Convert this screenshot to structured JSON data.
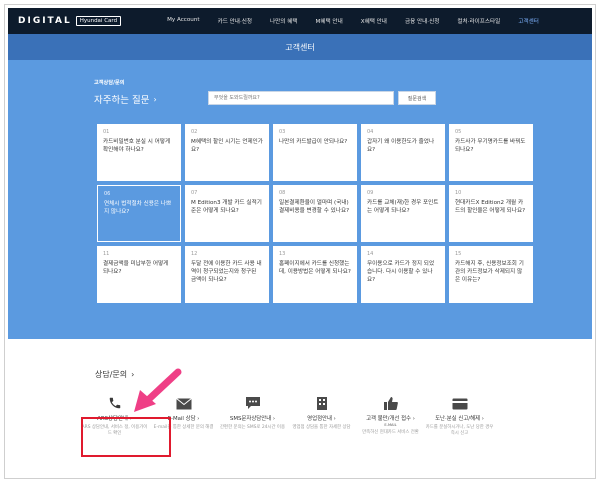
{
  "nav": {
    "logo_text": "DIGITAL",
    "logo_badge": "Hyundai Card",
    "items": [
      "My Account",
      "카드 안내·신청",
      "나만의 혜택",
      "M혜택 안내",
      "X혜택 안내",
      "금융 안내·신청",
      "컬처·라이프스타일",
      "고객센터"
    ]
  },
  "header": {
    "title": "고객센터"
  },
  "faq": {
    "breadcrumb": "고객상담/문의",
    "heading": "자주하는 질문",
    "search_placeholder": "무엇을 도와드릴까요?",
    "search_button": "질문검색",
    "cards": [
      {
        "num": "01",
        "text": "카드비밀번호 분실 시 어떻게 확인해야 하나요?"
      },
      {
        "num": "02",
        "text": "M혜택의 할인 시기는 언제인가요?"
      },
      {
        "num": "03",
        "text": "나만의 카드발급이 안되나요?"
      },
      {
        "num": "04",
        "text": "갑자기 왜 이용한도가 줄었나요?"
      },
      {
        "num": "05",
        "text": "카드사가 무기명카드를 바꿔도 되나요?"
      },
      {
        "num": "06",
        "text": "연체시 법적절차 신용은 나쁘지 않나요?"
      },
      {
        "num": "07",
        "text": "M Edition3 개발 카드 실적기준은 어떻게 되나요?"
      },
      {
        "num": "08",
        "text": "일본결제환율이 얼마며 (국내)결제비용을 변경할 수 있나요?"
      },
      {
        "num": "09",
        "text": "카드를 교체(재)한 경우 포인트는 어떻게 되나요?"
      },
      {
        "num": "10",
        "text": "현대카드X Edition2 개월 카드의 할인율은 어떻게 되나요?"
      },
      {
        "num": "11",
        "text": "결제금액을 미납부한 어떻게 되나요?"
      },
      {
        "num": "12",
        "text": "두달 전에 이용한 카드 사용 내역이 청구되었는지와 청구된 금액이 되나요?"
      },
      {
        "num": "13",
        "text": "홈페이지에서 카드를 신청했는데, 이용방법은 어떻게 되나요?"
      },
      {
        "num": "14",
        "text": "무이용으로 카드가 정지 되었습니다. 다시 이용할 수 있나요?"
      },
      {
        "num": "15",
        "text": "카드해지 후, 신용정보조회 기관의 카드정보가 삭제되지 않은 이유는?"
      }
    ]
  },
  "consult": {
    "title": "상담/문의",
    "services": [
      {
        "icon": "phone-icon",
        "label": "ARS상담안내",
        "desc": "ARS 상담안내, 서비스 정, 이용가이드 확인"
      },
      {
        "icon": "mail-icon",
        "label": "E-Mail 상담",
        "desc": "E-mail을 통한 상세한 문의 해결"
      },
      {
        "icon": "chat-icon",
        "label": "SMS문자상담안내",
        "desc": "간편한 문의는 SMS로 24시간 이용"
      },
      {
        "icon": "building-icon",
        "label": "영업점안내",
        "desc": "영업점 상담을 통한 자세한 상담"
      },
      {
        "icon": "thumbs-up-icon",
        "label": "고객 불만/개선 접수",
        "sub": "E-MAIL",
        "desc": "만족하신 현대카드 서비스 전환"
      },
      {
        "icon": "card-icon",
        "label": "도난·분실 신고/해제",
        "desc": "카드를 분실하시거나, 도난 당한 경우 즉시 신고"
      }
    ]
  },
  "colors": {
    "nav_bg": "#0d1b2c",
    "blue_band": "#5b9ae0",
    "title_bar": "#3a71b8",
    "highlight": "#e01a2e",
    "arrow": "#ef3f86"
  }
}
